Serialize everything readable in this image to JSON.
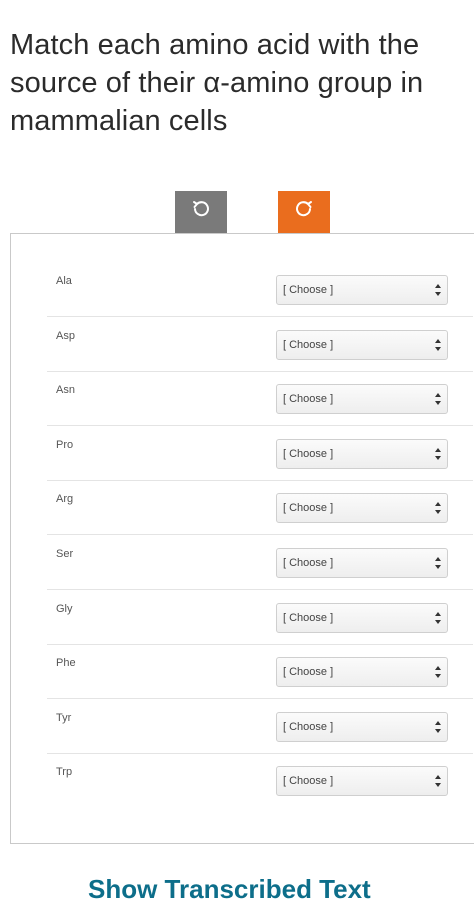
{
  "question": {
    "title": "Match each amino acid with the source of their α-amino group in mammalian cells"
  },
  "toolbar": {
    "undo_icon": "undo-icon",
    "redo_icon": "redo-icon",
    "undo_color": "#7a7a7a",
    "redo_color": "#ea6d1e"
  },
  "matching": {
    "rows": [
      {
        "label": "Ala",
        "selected": "[ Choose ]"
      },
      {
        "label": "Asp",
        "selected": "[ Choose ]"
      },
      {
        "label": "Asn",
        "selected": "[ Choose ]"
      },
      {
        "label": "Pro",
        "selected": "[ Choose ]"
      },
      {
        "label": "Arg",
        "selected": "[ Choose ]"
      },
      {
        "label": "Ser",
        "selected": "[ Choose ]"
      },
      {
        "label": "Gly",
        "selected": "[ Choose ]"
      },
      {
        "label": "Phe",
        "selected": "[ Choose ]"
      },
      {
        "label": "Tyr",
        "selected": "[ Choose ]"
      },
      {
        "label": "Trp",
        "selected": "[ Choose ]"
      }
    ]
  },
  "footer": {
    "link_label": "Show Transcribed Text"
  }
}
